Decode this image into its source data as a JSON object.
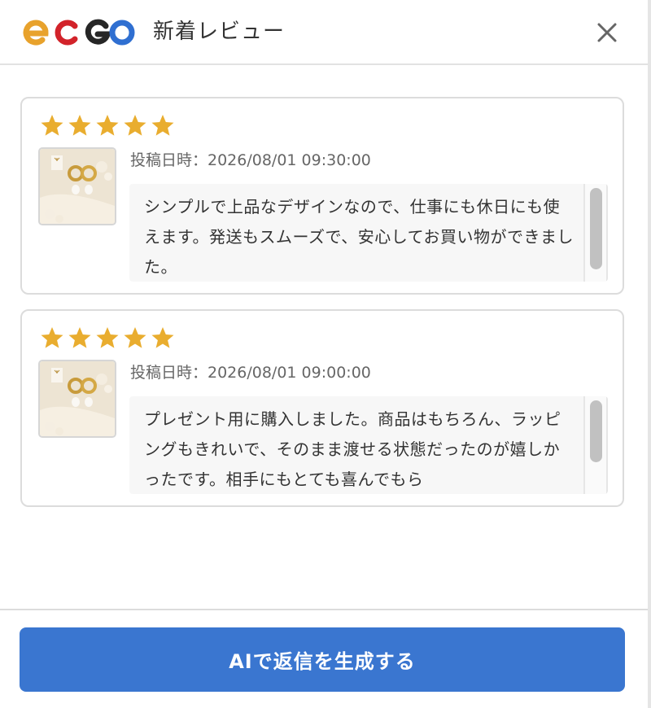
{
  "header": {
    "logo_text": "ecgo",
    "title": "新着レビュー",
    "close_icon": "close-icon"
  },
  "colors": {
    "star": "#e9ad2f",
    "accent": "#3a76d0",
    "logo_e": "#e8a22c",
    "logo_c": "#d2232a",
    "logo_g": "#262626",
    "logo_o": "#2f6fd1"
  },
  "reviews": [
    {
      "rating": 5,
      "rating_max": 5,
      "image_icon": "product-image-earrings",
      "posted": "投稿日時：2026/08/01 09:30:00",
      "body": "シンプルで上品なデザインなので、仕事にも休日にも使えます。発送もスムーズで、安心してお買い物ができました。"
    },
    {
      "rating": 5,
      "rating_max": 5,
      "image_icon": "product-image-earrings",
      "posted": "投稿日時：2026/08/01 09:00:00",
      "body": "プレゼント用に購入しました。商品はもちろん、ラッピングもきれいで、そのまま渡せる状態だったのが嬉しかったです。相手にもとても喜んでもら"
    }
  ],
  "footer": {
    "generate_label": "AIで返信を生成する"
  }
}
